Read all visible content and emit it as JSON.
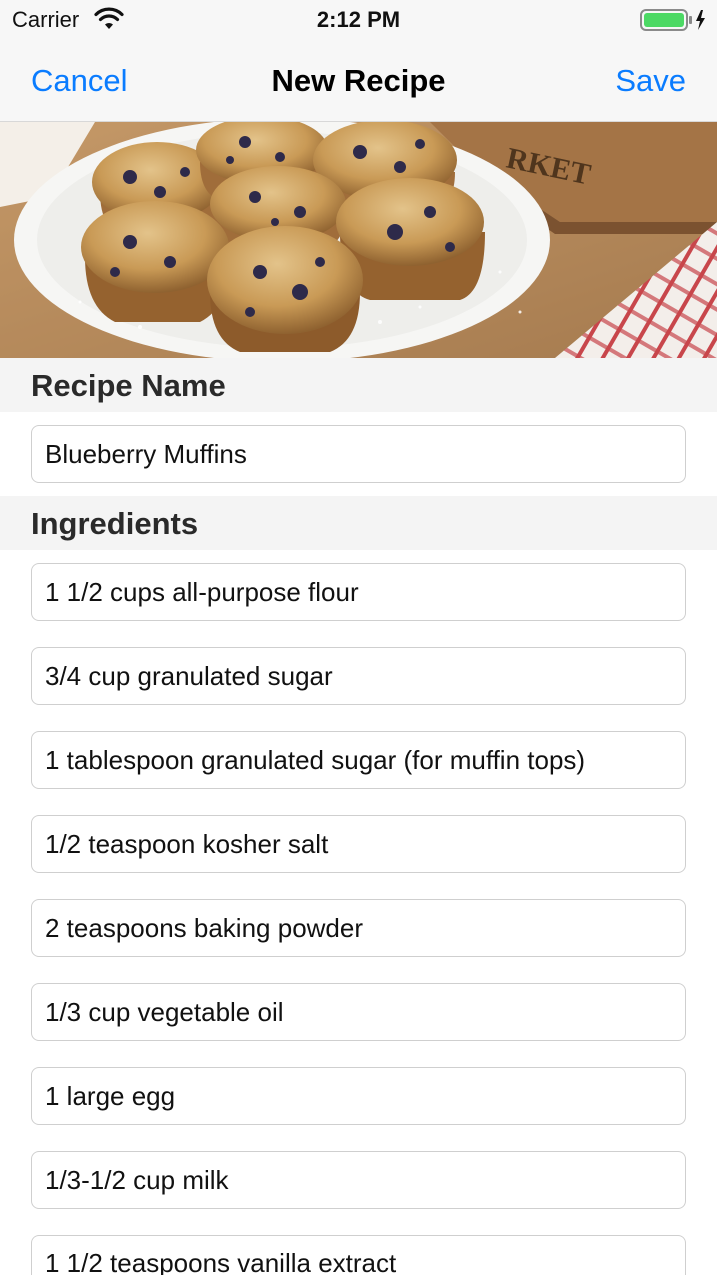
{
  "status_bar": {
    "carrier": "Carrier",
    "time": "2:12 PM",
    "wifi_icon": "wifi-icon",
    "battery_icon": "battery-charging-icon"
  },
  "nav": {
    "cancel_label": "Cancel",
    "title": "New Recipe",
    "save_label": "Save",
    "accent_color": "#0a7cff"
  },
  "hero_image": {
    "subject": "blueberry muffins on a white plate"
  },
  "recipe_name": {
    "header": "Recipe Name",
    "value": "Blueberry Muffins"
  },
  "ingredients": {
    "header": "Ingredients",
    "items": [
      "1 1/2 cups all-purpose flour",
      "3/4 cup granulated sugar",
      "1 tablespoon granulated sugar (for muffin tops)",
      "1/2 teaspoon kosher salt",
      "2 teaspoons baking powder",
      "1/3 cup vegetable oil",
      "1 large egg",
      "1/3-1/2 cup milk",
      "1 1/2 teaspoons vanilla extract"
    ]
  }
}
